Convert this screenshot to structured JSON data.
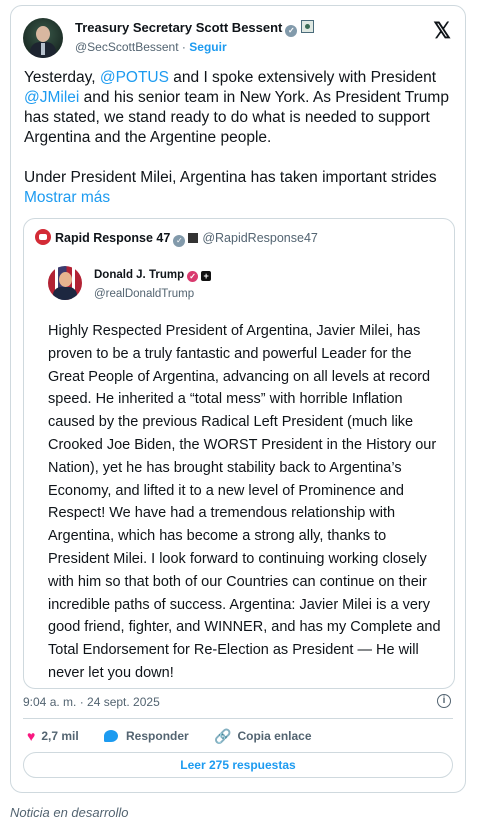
{
  "tweet": {
    "display_name": "Treasury Secretary Scott Bessent",
    "handle": "@SecScottBessent",
    "separator": "·",
    "follow_label": "Seguir",
    "x_logo": "𝕏",
    "paragraph1_a": "Yesterday, ",
    "mention1": "@POTUS",
    "paragraph1_b": " and I spoke extensively with President ",
    "mention2": "@JMilei",
    "paragraph1_c": " and his senior team in New York.  As President Trump has stated, we stand ready to do what is needed to support Argentina and the Argentine people.",
    "paragraph2": "Under President Milei, Argentina has taken important strides ",
    "show_more": "Mostrar más",
    "timestamp": "9:04 a. m. · 24 sept. 2025",
    "info_icon": "i"
  },
  "quoted": {
    "display_name": "Rapid Response 47",
    "handle": "@RapidResponse47",
    "inner": {
      "display_name": "Donald J. Trump",
      "handle": "@realDonaldTrump",
      "text": "Highly Respected President of Argentina, Javier Milei, has proven to be a truly fantastic and powerful Leader for the Great People of Argentina, advancing on all levels at record speed. He inherited a “total mess” with horrible Inflation caused by the previous Radical Left President (much like Crooked Joe Biden, the WORST President in the History our Nation), yet he has brought stability back to Argentina’s Economy, and lifted it to a new level of Prominence and Respect! We have had a tremendous relationship with Argentina, which has become a strong ally, thanks to President Milei. I look forward to continuing working closely with him so that both of our Countries can continue on their incredible paths of success. Argentina: Javier Milei is a very good friend, fighter, and WINNER, and has my Complete and Total Endorsement for Re-Election as President — He will never let you down!"
    }
  },
  "actions": {
    "likes": "2,7 mil",
    "reply_label": "Responder",
    "copy_link_label": "Copia enlace",
    "read_replies_label": "Leer 275 respuestas"
  },
  "footer_text": "Noticia en desarrollo",
  "icons": {
    "heart": "♥",
    "link": "🔗",
    "check": "✓",
    "plus": "+"
  },
  "colors": {
    "accent": "#1d9bf0",
    "like": "#f91880",
    "muted": "#536471",
    "border": "#cfd9de"
  }
}
